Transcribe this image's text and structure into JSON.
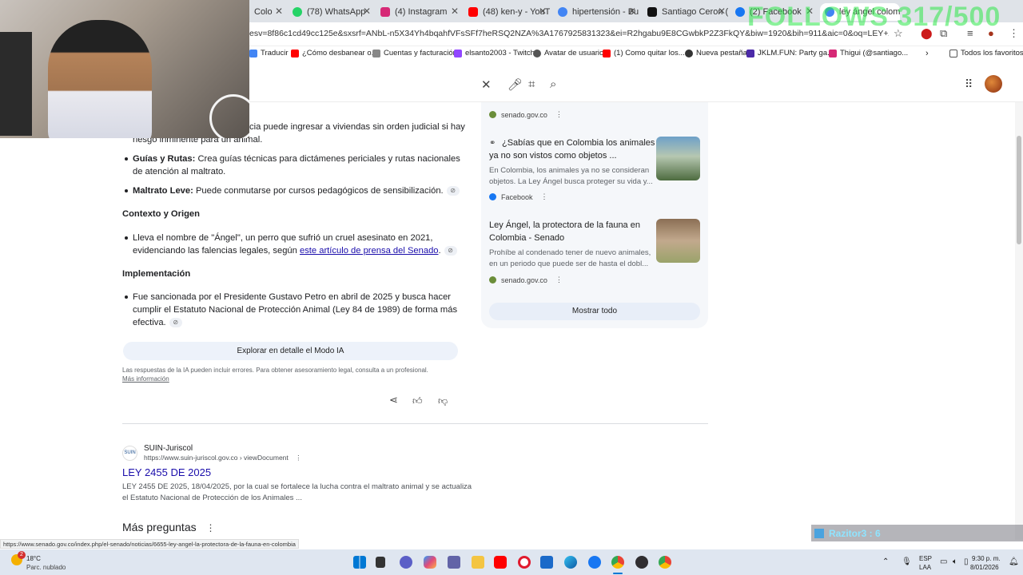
{
  "browser": {
    "tabs": [
      {
        "label": "Colo",
        "color": "#c98a2b"
      },
      {
        "label": "(78) WhatsApp",
        "color": "#25d366"
      },
      {
        "label": "(4) Instagram",
        "color": "#d62976"
      },
      {
        "label": "(48) ken-y - YouT",
        "color": "#ff0000"
      },
      {
        "label": "hipertensión - Bu",
        "color": "#4285f4"
      },
      {
        "label": "Santiago Ceron (",
        "color": "#111111"
      },
      {
        "label": "(2) Facebook",
        "color": "#1877f2"
      },
      {
        "label": "ley ángel colombi",
        "color": "#4285f4"
      }
    ],
    "url": "esv=8f86c1cd49cc125e&sxsrf=ANbL-n5X34Yh4bqahfVFsSFf7heRSQ2NZA%3A1767925831323&ei=R2hgabu9E8CGwbkP2Z3FkQY&biw=1920&bih=911&aic=0&oq=LEY+ANGEL+&gs_lp=Egxnd...",
    "bookmarks": [
      {
        "label": "Traducir",
        "color": "#4285f4"
      },
      {
        "label": "¿Cómo desbanear o...",
        "color": "#ff0000"
      },
      {
        "label": "Cuentas y facturación",
        "color": "#888888"
      },
      {
        "label": "elsanto2003 - Twitch",
        "color": "#9146ff"
      },
      {
        "label": "Avatar de usuario",
        "color": "#555555"
      },
      {
        "label": "(1) Como quitar los...",
        "color": "#ff0000"
      },
      {
        "label": "Nueva pestaña",
        "color": "#333333"
      },
      {
        "label": "JKLM.FUN: Party ga...",
        "color": "#4b2aa8"
      },
      {
        "label": "Thigui (@santiago...",
        "color": "#d62976"
      }
    ],
    "all_bookmarks": "Todos los favoritos",
    "status_url": "https://www.senado.gov.co/index.php/el-senado/noticias/6655-ley-angel-la-protectora-de-la-fauna-en-colombia"
  },
  "ai": {
    "line1a": "cia puede ingresar a viviendas sin orden judicial si hay",
    "line1b": "riesgo inminente para un animal.",
    "guias_bold": "Guías y Rutas:",
    "guias_text": " Crea guías técnicas para dictámenes periciales y rutas nacionales",
    "guias_text2": "de atención al maltrato.",
    "maltrato_bold": "Maltrato Leve:",
    "maltrato_text": " Puede conmutarse por cursos pedagógicos de sensibilización.",
    "contexto_heading": "Contexto y Origen",
    "contexto_l1": "Lleva el nombre de \"Ángel\", un perro que sufrió un cruel asesinato en 2021,",
    "contexto_l2a": "evidenciando las falencias legales, según ",
    "contexto_link": "este artículo de prensa del Senado",
    "contexto_l2b": ".",
    "impl_heading": "Implementación",
    "impl_l1": "Fue sancionada por el Presidente Gustavo Petro en abril de 2025 y busca hacer",
    "impl_l2": "cumplir el Estatuto Nacional de Protección Animal (Ley 84 de 1989) de forma más",
    "impl_l3": "efectiva.",
    "explore": "Explorar en detalle el Modo IA",
    "disclaimer": "Las respuestas de la IA pueden incluir errores. Para obtener asesoramiento legal, consulta a un profesional.",
    "more_info": "Más información"
  },
  "sources": {
    "top_site": "senado.gov.co",
    "items": [
      {
        "title_l1": "¿Sabías que en Colombia los animales",
        "title_l2": "ya no son vistos como objetos ...",
        "snip_l1": "En Colombia, los animales ya no se consideran",
        "snip_l2": "objetos. La Ley Ángel busca proteger su vida y...",
        "site": "Facebook"
      },
      {
        "title_l1": "Ley Ángel, la protectora de la fauna en",
        "title_l2": "Colombia - Senado",
        "snip_l1": "Prohíbe al condenado tener de nuevo animales,",
        "snip_l2": "en un periodo que puede ser de hasta el dobl...",
        "site": "senado.gov.co"
      }
    ],
    "show_all": "Mostrar todo"
  },
  "result": {
    "site_name": "SUIN-Juriscol",
    "site_url": "https://www.suin-juriscol.gov.co › viewDocument",
    "title": "LEY 2455 DE 2025",
    "snippet_l1": "LEY 2455 DE 2025, 18/04/2025, por la cual se fortalece la lucha contra el maltrato animal y se actualiza",
    "snippet_l2": "el Estatuto Nacional de Protección de los Animales ..."
  },
  "more_questions": "Más preguntas",
  "overlay": {
    "follows": "FOLLOWS 317/500",
    "razi": "Razitor3 : 6"
  },
  "taskbar": {
    "weather_temp": "18°C",
    "weather_desc": "Parc. nublado",
    "weather_badge": "2",
    "lang1": "ESP",
    "lang2": "LAA",
    "time": "9:30 p. m.",
    "date": "8/01/2026"
  }
}
